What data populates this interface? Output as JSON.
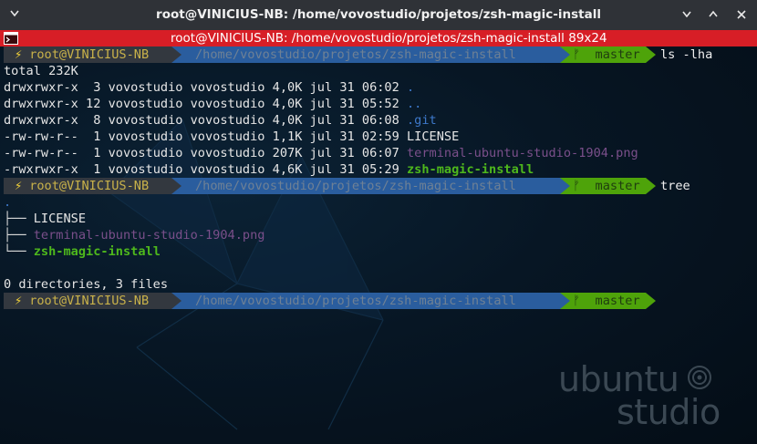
{
  "window": {
    "title": "root@VINICIUS-NB: /home/vovostudio/projetos/zsh-magic-install",
    "buttons": [
      "menu",
      "minimize",
      "maximize",
      "close"
    ]
  },
  "pane_header": {
    "text": "root@VINICIUS-NB: /home/vovostudio/projetos/zsh-magic-install 89x24",
    "color": "#d71e26"
  },
  "prompt": {
    "bolt": "⚡",
    "user": "root@VINICIUS-NB",
    "path": "/home/vovostudio/projetos/zsh-magic-install",
    "branch_icon": "ᚠ",
    "branch": "master"
  },
  "commands": [
    "ls -lha",
    "tree"
  ],
  "ls_output": {
    "total": "total 232K",
    "rows": [
      {
        "perms": "drwxrwxr-x",
        "links": " 3",
        "owner": "vovostudio",
        "group": "vovostudio",
        "size": "4,0K",
        "date": "jul 31 06:02",
        "name": ".",
        "kind": "dir"
      },
      {
        "perms": "drwxrwxr-x",
        "links": "12",
        "owner": "vovostudio",
        "group": "vovostudio",
        "size": "4,0K",
        "date": "jul 31 05:52",
        "name": "..",
        "kind": "dir"
      },
      {
        "perms": "drwxrwxr-x",
        "links": " 8",
        "owner": "vovostudio",
        "group": "vovostudio",
        "size": "4,0K",
        "date": "jul 31 06:08",
        "name": ".git",
        "kind": "dir"
      },
      {
        "perms": "-rw-rw-r--",
        "links": " 1",
        "owner": "vovostudio",
        "group": "vovostudio",
        "size": "1,1K",
        "date": "jul 31 02:59",
        "name": "LICENSE",
        "kind": "file"
      },
      {
        "perms": "-rw-rw-r--",
        "links": " 1",
        "owner": "vovostudio",
        "group": "vovostudio",
        "size": "207K",
        "date": "jul 31 06:07",
        "name": "terminal-ubuntu-studio-1904.png",
        "kind": "img"
      },
      {
        "perms": "-rwxrwxr-x",
        "links": " 1",
        "owner": "vovostudio",
        "group": "vovostudio",
        "size": "4,6K",
        "date": "jul 31 05:29",
        "name": "zsh-magic-install",
        "kind": "exe"
      }
    ]
  },
  "tree_output": {
    "root": ".",
    "items": [
      {
        "branch": "├── ",
        "name": "LICENSE",
        "kind": "file"
      },
      {
        "branch": "├── ",
        "name": "terminal-ubuntu-studio-1904.png",
        "kind": "img"
      },
      {
        "branch": "└── ",
        "name": "zsh-magic-install",
        "kind": "exe"
      }
    ],
    "summary": "0 directories, 3 files"
  },
  "wallpaper": {
    "logo_line1": "ubuntu",
    "logo_line2": "studio"
  },
  "colors": {
    "terminal_bg": "#071624",
    "titlebar_bg": "#2f3237",
    "prompt_user_bg": "#33383f",
    "prompt_path_bg": "#2a5d9e",
    "prompt_git_bg": "#4ea30a",
    "dir_color": "#3d78c9",
    "img_color": "#7a4f8a",
    "exe_color": "#4eb81c"
  }
}
